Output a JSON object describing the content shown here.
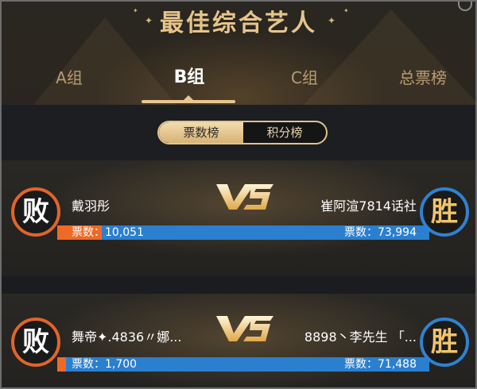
{
  "header": {
    "title": "最佳综合艺人",
    "stars": [
      "✦",
      "✦"
    ]
  },
  "tabs": [
    {
      "label": "A组",
      "selected": false
    },
    {
      "label": "B组",
      "selected": true
    },
    {
      "label": "C组",
      "selected": false
    },
    {
      "label": "总票榜",
      "selected": false
    }
  ],
  "toggle": {
    "options": [
      {
        "label": "票数榜",
        "selected": true
      },
      {
        "label": "积分榜",
        "selected": false
      }
    ]
  },
  "vs_label": "VS",
  "matches": [
    {
      "left": {
        "name": "戴羽彤",
        "votes_label": "票数：10,051",
        "votes": 10051,
        "result": "败"
      },
      "right": {
        "name": "崔阿渲7814话社",
        "votes_label": "票数：73,994",
        "votes": 73994,
        "result": "胜"
      }
    },
    {
      "left": {
        "name": "舞帝✦.4836〃娜...",
        "votes_label": "票数：1,700",
        "votes": 1700,
        "result": "败"
      },
      "right": {
        "name": "8898丶李先生 「...",
        "votes_label": "票数：71,488",
        "votes": 71488,
        "result": "胜"
      }
    }
  ],
  "colors": {
    "gold": "#e6c58a",
    "lose_orange": "#ee6a26",
    "win_blue": "#2a7fcf"
  },
  "icons": [
    "close-icon",
    "vs-logo-icon"
  ]
}
